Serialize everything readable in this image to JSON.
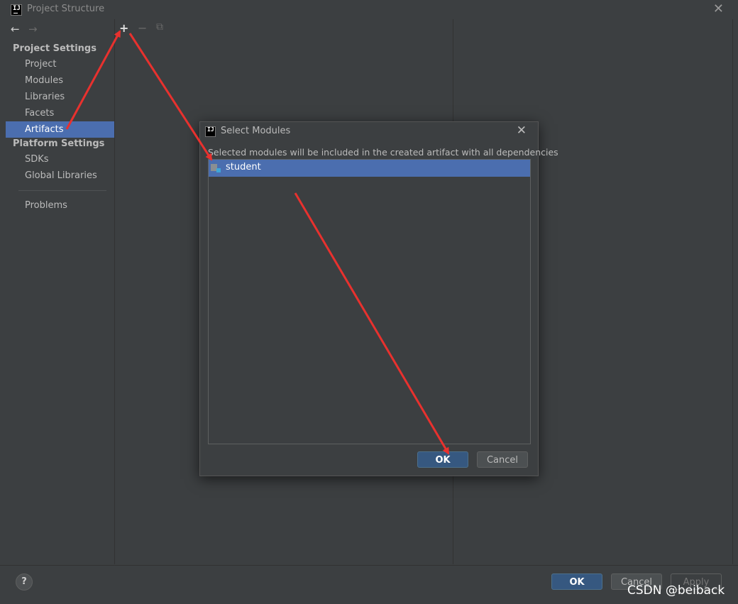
{
  "window": {
    "title": "Project Structure",
    "close_glyph": "✕"
  },
  "nav": {
    "back_icon": "←",
    "forward_icon": "→",
    "project_settings_title": "Project Settings",
    "project_settings_items": [
      "Project",
      "Modules",
      "Libraries",
      "Facets",
      "Artifacts"
    ],
    "platform_settings_title": "Platform Settings",
    "platform_settings_items": [
      "SDKs",
      "Global Libraries"
    ],
    "problems_label": "Problems",
    "selected": "Artifacts"
  },
  "toolbar": {
    "add_icon": "+",
    "remove_icon": "−",
    "copy_icon": "⧉"
  },
  "dialog": {
    "title": "Select Modules",
    "close_glyph": "✕",
    "description": "Selected modules will be included in the created artifact with all dependencies",
    "modules": [
      {
        "name": "student",
        "selected": true
      }
    ],
    "ok_label": "OK",
    "cancel_label": "Cancel"
  },
  "footer": {
    "help_label": "?",
    "ok_label": "OK",
    "cancel_label": "Cancel",
    "apply_label": "Apply"
  },
  "watermark": "CSDN @beiback",
  "colors": {
    "background": "#3c3f41",
    "selection": "#4b6eaf",
    "default_button": "#365880",
    "annotation_arrow": "#e8312e"
  }
}
